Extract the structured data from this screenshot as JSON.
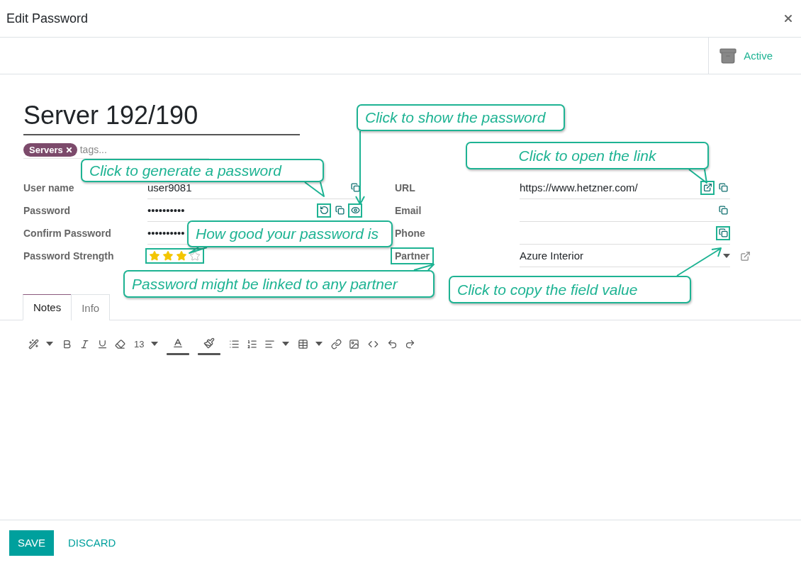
{
  "dialog": {
    "title": "Edit Password"
  },
  "status_button": {
    "label": "Active"
  },
  "record": {
    "name": "Server 192/190",
    "tags": [
      {
        "label": "Servers",
        "color": "#7c4a6b"
      }
    ],
    "tags_placeholder": "tags..."
  },
  "fields_left": [
    {
      "label": "User name",
      "kind": "text",
      "value": "user9081",
      "label_highlighted": false,
      "actions": [
        {
          "kind": "copy",
          "highlighted": false
        }
      ]
    },
    {
      "label": "Password",
      "kind": "text",
      "value": "••••••••••",
      "label_highlighted": false,
      "actions": [
        {
          "kind": "generate",
          "highlighted": true
        },
        {
          "kind": "copy",
          "highlighted": false
        },
        {
          "kind": "show",
          "highlighted": true
        }
      ]
    },
    {
      "label": "Confirm Password",
      "kind": "text",
      "value": "••••••••••",
      "label_highlighted": false
    },
    {
      "label": "Password Strength",
      "kind": "stars",
      "stars": 3,
      "highlighted": true,
      "label_highlighted": false
    }
  ],
  "fields_right": [
    {
      "label": "URL",
      "kind": "text",
      "value": "https://www.hetzner.com/",
      "label_highlighted": false,
      "actions": [
        {
          "kind": "open",
          "highlighted": true
        },
        {
          "kind": "copy",
          "highlighted": false
        }
      ]
    },
    {
      "label": "Email",
      "kind": "text",
      "label_highlighted": false,
      "actions": [
        {
          "kind": "copy",
          "highlighted": false
        }
      ]
    },
    {
      "label": "Phone",
      "kind": "text",
      "label_highlighted": false,
      "actions": [
        {
          "kind": "copy",
          "highlighted": true
        }
      ]
    },
    {
      "label": "Partner",
      "kind": "select",
      "value": "Azure Interior",
      "label_highlighted": true
    }
  ],
  "tabs": [
    {
      "label": "Notes",
      "selected": true
    },
    {
      "label": "Info",
      "selected": false
    }
  ],
  "editor_toolbar": {
    "font_size": "13"
  },
  "callouts": [
    "Click to show the password",
    "Click to open the link",
    "Click to generate a password",
    "How good your password is",
    "Password might be linked to any partner",
    "Click to copy the field value"
  ],
  "buttons": {
    "save": "SAVE",
    "discard": "DISCARD"
  }
}
